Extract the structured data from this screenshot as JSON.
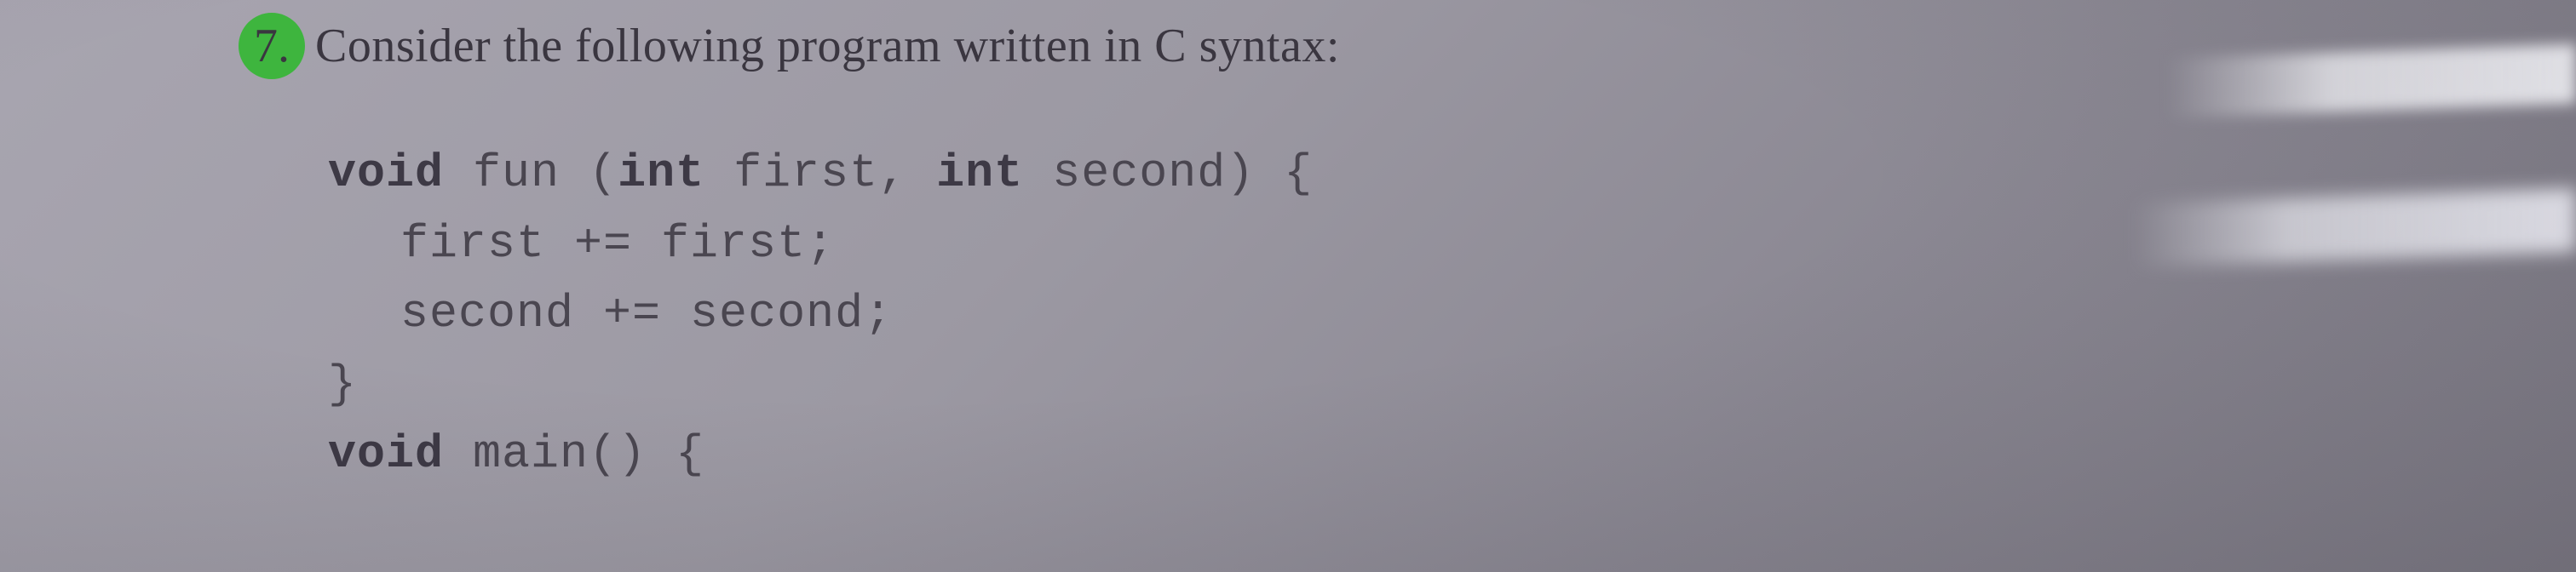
{
  "question": {
    "number": "7.",
    "text": "Consider the following program written in C syntax:"
  },
  "code": {
    "line1_kw1": "void",
    "line1_rest1": " fun (",
    "line1_kw2": "int",
    "line1_rest2": " first, ",
    "line1_kw3": "int",
    "line1_rest3": " second) {",
    "line2": "first += first;",
    "line3": "second += second;",
    "line4": "}",
    "line5_kw": "void",
    "line5_rest": " main() {"
  }
}
